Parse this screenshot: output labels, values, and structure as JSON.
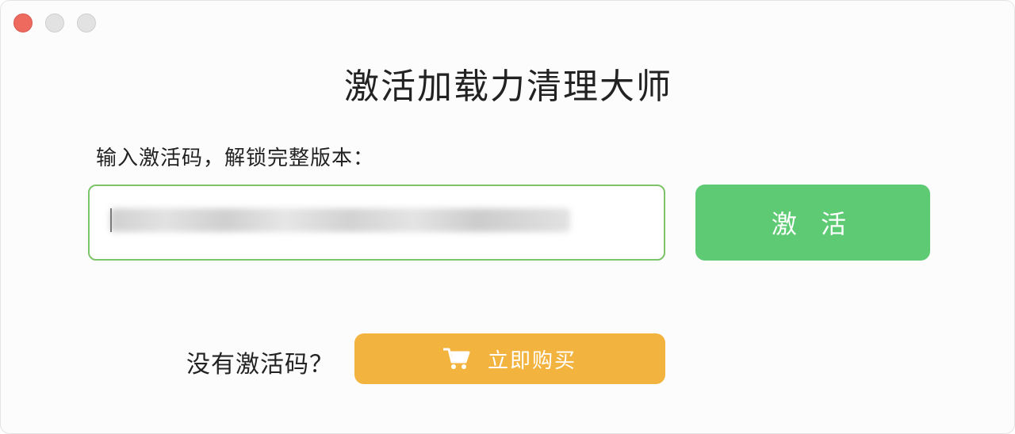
{
  "window": {
    "title": "激活加载力清理大师"
  },
  "form": {
    "prompt": "输入激活码，解锁完整版本：",
    "activate_label": "激 活"
  },
  "footer": {
    "no_code_label": "没有激活码？",
    "buy_label": "立即购买"
  },
  "icons": {
    "cart": "shopping-cart-icon"
  },
  "colors": {
    "activate_green": "#5ecb74",
    "input_border_green": "#7cc36a",
    "buy_orange": "#f3b33f",
    "close_red": "#ee6a5f"
  }
}
